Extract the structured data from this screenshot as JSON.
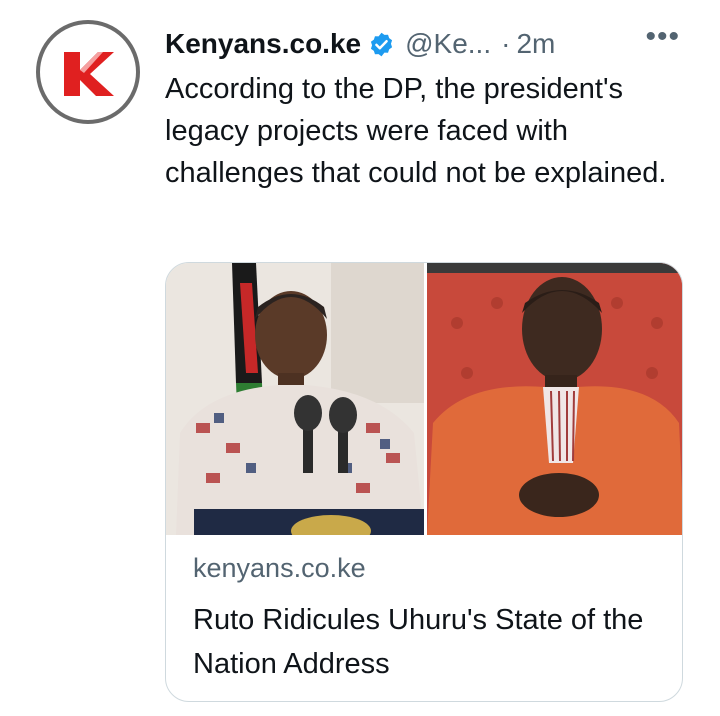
{
  "tweet": {
    "author_name": "Kenyans.co.ke",
    "handle": "@Ke...",
    "separator": "·",
    "time": "2m",
    "more_label": "•••",
    "verified": true,
    "avatar_icon": "kenyans-logo-icon",
    "text": "According to the DP, the president's legacy projects were faced with challenges that could not be explained."
  },
  "card": {
    "domain": "kenyans.co.ke",
    "title": "Ruto Ridicules Uhuru's State of the Nation Address"
  },
  "colors": {
    "verified_blue": "#1d9bf0",
    "logo_red": "#e02020",
    "secondary_text": "#536471"
  }
}
